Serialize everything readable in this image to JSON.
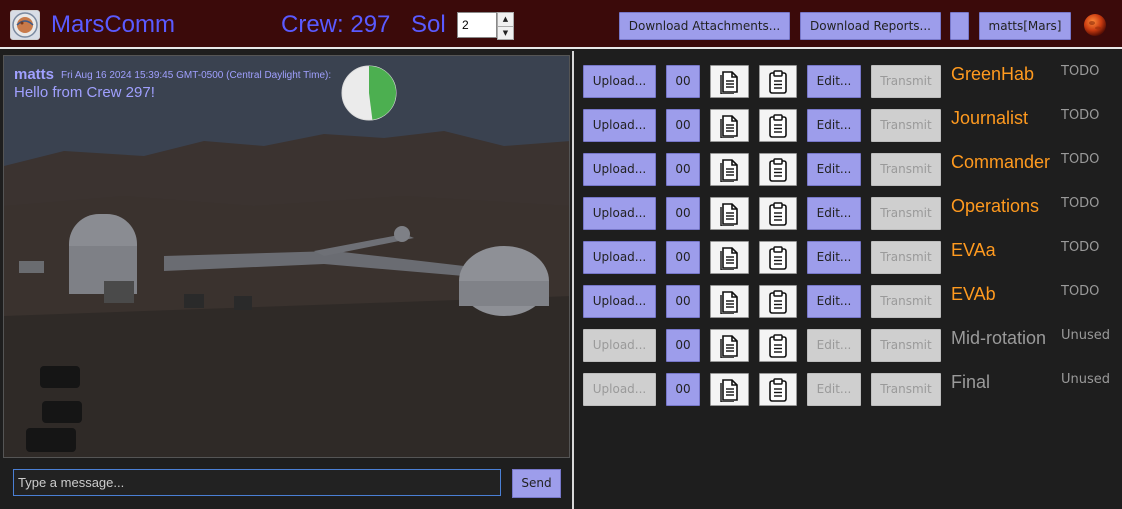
{
  "header": {
    "app_title": "MarsComm",
    "crew_label": "Crew: 297",
    "sol_label": "Sol",
    "sol_value": "2",
    "download_attachments_label": "Download Attachments...",
    "download_reports_label": "Download Reports...",
    "blank_button_label": "",
    "user_label": "matts[Mars]",
    "logo_icon": "mars-society-logo-icon",
    "mars_icon": "mars-planet-icon"
  },
  "chat": {
    "last_message": {
      "user": "matts",
      "timestamp": "Fri Aug 16 2024 15:39:45 GMT-0500 (Central Daylight Time):",
      "text": "Hello from Crew 297!"
    },
    "progress_fraction": 0.48,
    "input_placeholder": "Type a message...",
    "send_label": "Send"
  },
  "colors": {
    "accent": "#9d9deb",
    "title": "#5a5aff",
    "role_active": "#ff9a1f",
    "role_inactive": "#9a9a9a",
    "header_bg": "#3b0a0a",
    "pie_fill": "#4caf50"
  },
  "reports": [
    {
      "upload": "Upload...",
      "count": "00",
      "edit": "Edit...",
      "transmit": "Transmit",
      "role": "GreenHab",
      "status": "TODO",
      "active": true
    },
    {
      "upload": "Upload...",
      "count": "00",
      "edit": "Edit...",
      "transmit": "Transmit",
      "role": "Journalist",
      "status": "TODO",
      "active": true
    },
    {
      "upload": "Upload...",
      "count": "00",
      "edit": "Edit...",
      "transmit": "Transmit",
      "role": "Commander",
      "status": "TODO",
      "active": true
    },
    {
      "upload": "Upload...",
      "count": "00",
      "edit": "Edit...",
      "transmit": "Transmit",
      "role": "Operations",
      "status": "TODO",
      "active": true
    },
    {
      "upload": "Upload...",
      "count": "00",
      "edit": "Edit...",
      "transmit": "Transmit",
      "role": "EVAa",
      "status": "TODO",
      "active": true
    },
    {
      "upload": "Upload...",
      "count": "00",
      "edit": "Edit...",
      "transmit": "Transmit",
      "role": "EVAb",
      "status": "TODO",
      "active": true
    },
    {
      "upload": "Upload...",
      "count": "00",
      "edit": "Edit...",
      "transmit": "Transmit",
      "role": "Mid-rotation",
      "status": "Unused",
      "active": false
    },
    {
      "upload": "Upload...",
      "count": "00",
      "edit": "Edit...",
      "transmit": "Transmit",
      "role": "Final",
      "status": "Unused",
      "active": false
    }
  ]
}
